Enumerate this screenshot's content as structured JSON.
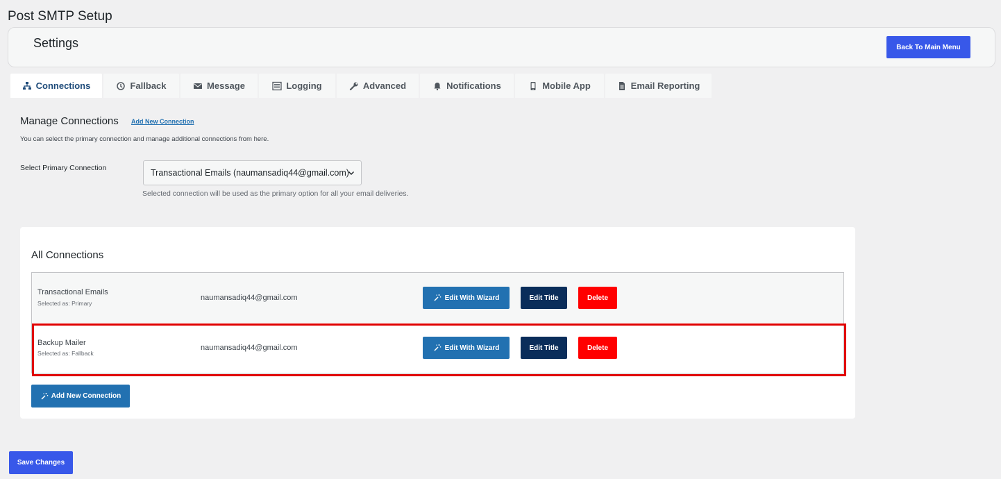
{
  "page": {
    "title": "Post SMTP Setup"
  },
  "header": {
    "title": "Settings",
    "back_label": "Back To Main Menu"
  },
  "tabs": [
    {
      "label": "Connections",
      "icon": "sitemap-icon",
      "active": true
    },
    {
      "label": "Fallback",
      "icon": "history-icon"
    },
    {
      "label": "Message",
      "icon": "envelope-icon"
    },
    {
      "label": "Logging",
      "icon": "list-icon"
    },
    {
      "label": "Advanced",
      "icon": "wrench-icon"
    },
    {
      "label": "Notifications",
      "icon": "bell-icon"
    },
    {
      "label": "Mobile App",
      "icon": "phone-icon"
    },
    {
      "label": "Email Reporting",
      "icon": "document-icon"
    }
  ],
  "manage": {
    "title": "Manage Connections",
    "add_link": "Add New Connection",
    "description": "You can select the primary connection and manage additional connections from here."
  },
  "primary": {
    "label": "Select Primary Connection",
    "selected": "Transactional Emails (naumansadiq44@gmail.com)",
    "help": "Selected connection will be used as the primary option for all your email deliveries."
  },
  "connections": {
    "title": "All Connections",
    "rows": [
      {
        "name": "Transactional Emails",
        "selected_as": "Selected as: Primary",
        "email": "naumansadiq44@gmail.com"
      },
      {
        "name": "Backup Mailer",
        "selected_as": "Selected as: Fallback",
        "email": "naumansadiq44@gmail.com"
      }
    ],
    "wizard_label": "Edit With Wizard",
    "edit_label": "Edit Title",
    "delete_label": "Delete",
    "add_label": "Add New Connection"
  },
  "footer": {
    "save_label": "Save Changes"
  },
  "colors": {
    "primary_blue": "#3858e9",
    "wizard_blue": "#2271b1",
    "navy": "#0a2d5a",
    "danger": "#ff0000",
    "highlight": "#e00000"
  }
}
